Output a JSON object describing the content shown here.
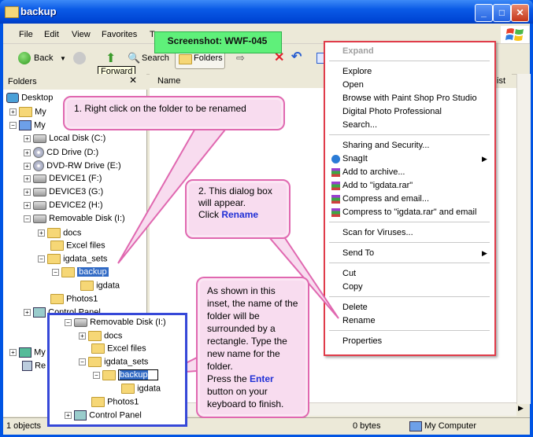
{
  "window": {
    "title": "backup"
  },
  "title_buttons": {
    "minimize": "_",
    "maximize": "□",
    "close": "✕"
  },
  "menu": [
    "File",
    "Edit",
    "View",
    "Favorites",
    "To"
  ],
  "toolbar": {
    "back": "Back",
    "search": "Search",
    "folders": "Folders",
    "tooltip": "Forward"
  },
  "badge": "Screenshot: WWF-045",
  "folders_pane": {
    "title": "Folders"
  },
  "tree": [
    "Desktop",
    "My",
    "My",
    "Local Disk (C:)",
    "CD Drive (D:)",
    "DVD-RW Drive (E:)",
    "DEVICE1 (F:)",
    "DEVICE3 (G:)",
    "DEVICE2 (H:)",
    "Removable Disk (I:)",
    "docs",
    "Excel files",
    "igdata_sets",
    "backup",
    "igdata",
    "Photos1",
    "Control Panel",
    "My",
    "Re"
  ],
  "list": {
    "col_name": "Name",
    "col_right": "ist"
  },
  "context_menu": {
    "items": [
      "Expand",
      "Explore",
      "Open",
      "Browse with Paint Shop Pro Studio",
      "Digital Photo Professional",
      "Search...",
      "Sharing and Security...",
      "SnagIt",
      "Add to archive...",
      "Add to \"igdata.rar\"",
      "Compress and email...",
      "Compress to \"igdata.rar\" and email",
      "Scan for Viruses...",
      "Send To",
      "Cut",
      "Copy",
      "Delete",
      "Rename",
      "Properties"
    ]
  },
  "callout1": "1. Right click on the folder to be renamed",
  "callout2": {
    "line1": "2. This dialog box",
    "line2": "will appear.",
    "line3": "Click ",
    "rename": "Rename"
  },
  "callout3": {
    "text1": "As shown in this inset, the name of the folder will be surrounded by a rectangle. Type the new name for the folder.",
    "text2a": "Press the ",
    "enter": "Enter",
    "text2b": " button on your keyboard to finish."
  },
  "inset": {
    "items": [
      "Removable Disk (I:)",
      "docs",
      "Excel files",
      "igdata_sets",
      "backup",
      "igdata",
      "Photos1",
      "Control Panel"
    ]
  },
  "status": {
    "objects": "1 objects",
    "size": "0 bytes",
    "location": "My Computer"
  },
  "colors": {
    "titlebar": "#0054e3",
    "selection": "#316ac5",
    "callout_fill": "#f8dcef",
    "callout_border": "#e068b0",
    "context_border": "#e03c4a",
    "inset_border": "#3648d8",
    "badge": "#5ff07a"
  }
}
